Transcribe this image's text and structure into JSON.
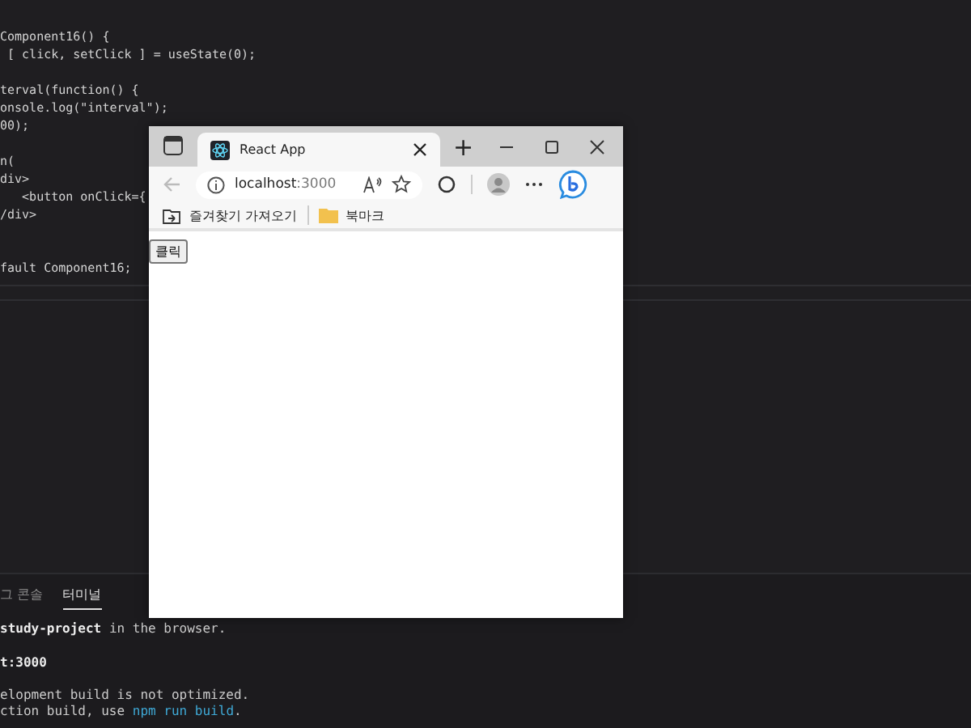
{
  "editor": {
    "code_blocks": [
      [
        "Component16() {",
        " [ click, setClick ] = useState(0);"
      ],
      [
        "terval(function() {",
        "onsole.log(\"interval\");",
        "00);"
      ],
      [
        "n(",
        "div>",
        "   <button onClick={",
        "/div>"
      ],
      [
        "fault Component16;"
      ]
    ]
  },
  "panel": {
    "tabs": [
      {
        "label": "그 콘솔",
        "selected": false
      },
      {
        "label": "터미널",
        "selected": true
      }
    ],
    "terminal_blocks": [
      [
        [
          {
            "kind": "bold",
            "text": "study-project"
          },
          {
            "kind": "plain",
            "text": " in the browser."
          }
        ]
      ],
      [
        [
          {
            "kind": "bold",
            "text": "t:3000"
          }
        ]
      ],
      [
        [
          {
            "kind": "plain",
            "text": "elopment build is not optimized."
          }
        ],
        [
          {
            "kind": "plain",
            "text": "ction build, use "
          },
          {
            "kind": "command",
            "text": "npm run build"
          },
          {
            "kind": "plain",
            "text": "."
          }
        ]
      ]
    ]
  },
  "browser": {
    "tab_title": "React App",
    "new_tab": "+",
    "url_host": "localhost",
    "url_port": ":3000",
    "favorites": [
      {
        "kind": "import",
        "label": "즐겨찾기 가져오기"
      },
      {
        "kind": "folder",
        "label": "북마크"
      }
    ],
    "page_button": "클릭"
  }
}
